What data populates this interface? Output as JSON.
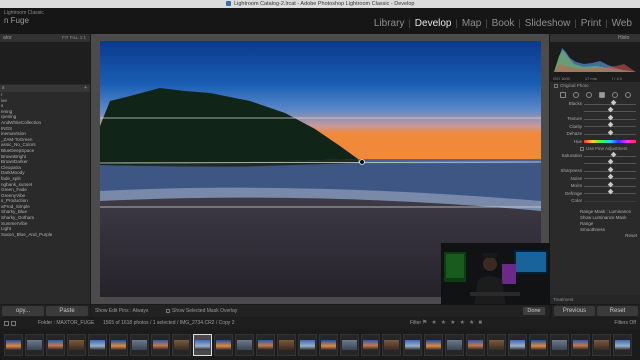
{
  "window": {
    "title": "Lightroom Catalog-2.lrcat - Adobe Photoshop Lightroom Classic - Develop"
  },
  "brand": {
    "line1": "Lightroom Classic",
    "line2": "n Fuge"
  },
  "modules": [
    "Library",
    "Develop",
    "Map",
    "Book",
    "Slideshow",
    "Print",
    "Web"
  ],
  "active_module": "Develop",
  "left_panel": {
    "navigator_label": "ator",
    "nav_options": "FIT   FILL   1:1",
    "presets_section": "s",
    "presets": [
      "r",
      "ive",
      "",
      "s",
      "",
      "",
      "ening",
      "rpening",
      "",
      "AndWhiteCollection",
      "INGS",
      "inemaVision",
      "_ZAM-ToGreen",
      "assic_No_Colors",
      "BlueDeepSpace",
      "BrownBright",
      "BrownDarker",
      "Cleopatra",
      "DarkMoody",
      "fade_split",
      "ngbank_sunset",
      "Green_Fade",
      "GreenyVibe",
      "s_Production",
      "aProd_Simple",
      "Sharky_Blue",
      "Sharky_Gotham",
      "SummerVibe",
      "Light",
      "Saxon_Blue_And_Purple"
    ],
    "copy_button": "opy...",
    "paste_button": "Paste"
  },
  "center": {
    "show_edit_pins": "Show Edit Pins : Always",
    "show_mask_overlay": "Show Selected Mask Overlay",
    "done_button": "Done"
  },
  "right_panel": {
    "header": "Histo",
    "hist_info": [
      "ISO 1600",
      "17 mm",
      "f / 4.0",
      ""
    ],
    "original_photo": "Original Photo",
    "sliders": [
      {
        "label": "Blacks",
        "value": 0.55
      },
      {
        "label": "",
        "value": 0.5
      },
      {
        "label": "Texture",
        "value": 0.5
      },
      {
        "label": "Clarity",
        "value": 0.5
      },
      {
        "label": "Dehaze",
        "value": 0.5
      }
    ],
    "hue_label": "Hue",
    "fine_adjustment": "Use Fine Adjustment",
    "sliders2": [
      {
        "label": "Saturation",
        "value": 0.55
      },
      {
        "label": "",
        "value": 0.5
      },
      {
        "label": "Sharpness",
        "value": 0.5
      },
      {
        "label": "Noise",
        "value": 0.5
      },
      {
        "label": "Moire",
        "value": 0.5
      },
      {
        "label": "Defringe",
        "value": 0.5
      }
    ],
    "color_label": "Color",
    "range_mask_label": "Range Mask : Luminance",
    "show_luminance_mask": "Show Luminance Mask",
    "range_label": "Range",
    "smoothness_label": "Smoothness",
    "reset_label": "Reset",
    "bottom_label": "Treatment",
    "previous_button": "Previous",
    "reset_button": "Reset"
  },
  "filmbar": {
    "nums": [
      "1",
      "2"
    ],
    "folder": "Folder : MAXTOR_FUGE",
    "count": "1565 of 1618 photos / 1 selected / IMG_2734.CR2 / Copy 2",
    "filter": "Filter :",
    "filters_off": "Filters Off"
  },
  "filmstrip": {
    "thumb_count": 30,
    "selected_index": 9
  },
  "colors": {
    "accent_sky_top": "#0a3a8c",
    "accent_sky_orange": "#f08a3a",
    "panel_bg": "#2a2a2a"
  }
}
